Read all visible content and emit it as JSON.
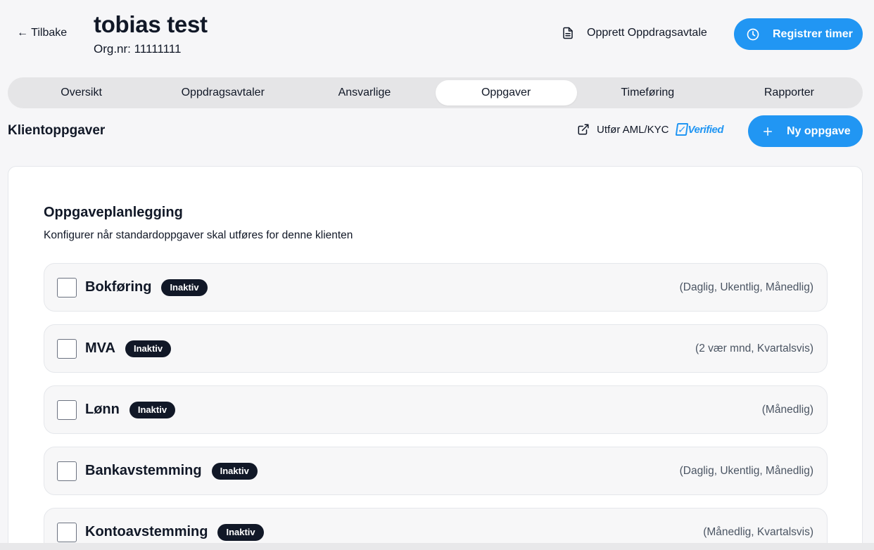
{
  "header": {
    "back_label": "← Tilbake",
    "client_name": "tobias test",
    "org_nr": "Org.nr: 11111111",
    "create_agreement_label": "Opprett Oppdragsavtale",
    "register_hours_label": "Registrer timer"
  },
  "tabs": [
    {
      "label": "Oversikt",
      "active": false
    },
    {
      "label": "Oppdragsavtaler",
      "active": false
    },
    {
      "label": "Ansvarlige",
      "active": false
    },
    {
      "label": "Oppgaver",
      "active": true
    },
    {
      "label": "Timeføring",
      "active": false
    },
    {
      "label": "Rapporter",
      "active": false
    }
  ],
  "section": {
    "title": "Klientoppgaver",
    "aml_label": "Utfør AML/KYC",
    "verified_logo_text": "Verified",
    "new_task_label": "Ny oppgave"
  },
  "planning": {
    "title": "Oppgaveplanlegging",
    "subtitle": "Konfigurer når standardoppgaver skal utføres for denne klienten",
    "tasks": [
      {
        "name": "Bokføring",
        "status": "Inaktiv",
        "frequency": "(Daglig, Ukentlig, Månedlig)",
        "checked": false
      },
      {
        "name": "MVA",
        "status": "Inaktiv",
        "frequency": "(2 vær mnd, Kvartalsvis)",
        "checked": false
      },
      {
        "name": "Lønn",
        "status": "Inaktiv",
        "frequency": "(Månedlig)",
        "checked": false
      },
      {
        "name": "Bankavstemming",
        "status": "Inaktiv",
        "frequency": "(Daglig, Ukentlig, Månedlig)",
        "checked": false
      },
      {
        "name": "Kontoavstemming",
        "status": "Inaktiv",
        "frequency": "(Månedlig, Kvartalsvis)",
        "checked": false
      }
    ]
  },
  "colors": {
    "primary": "#2196f3",
    "badge_bg": "#111827",
    "page_bg": "#f6f6f8"
  },
  "icons": [
    "document-icon",
    "clock-icon",
    "external-link-icon",
    "plus-icon"
  ]
}
